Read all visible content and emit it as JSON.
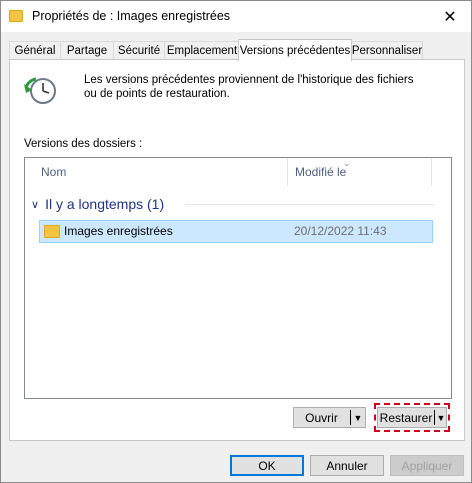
{
  "window": {
    "title": "Propriétés de : Images enregistrées",
    "close_label": "✕"
  },
  "tabs": [
    {
      "label": "Général"
    },
    {
      "label": "Partage"
    },
    {
      "label": "Sécurité"
    },
    {
      "label": "Emplacement"
    },
    {
      "label": "Versions précédentes"
    },
    {
      "label": "Personnaliser"
    }
  ],
  "active_tab": "Versions précédentes",
  "info": {
    "text": "Les versions précédentes proviennent de l'historique des fichiers ou de points de restauration.",
    "icon": "restore-clock-icon"
  },
  "folder_versions": {
    "label": "Versions des dossiers :",
    "columns": {
      "name": "Nom",
      "modified": "Modifié le"
    },
    "groups": [
      {
        "title": "Il y a longtemps (1)",
        "items": [
          {
            "name": "Images enregistrées",
            "modified": "20/12/2022 11:43",
            "icon": "folder-icon",
            "selected": true
          }
        ]
      }
    ]
  },
  "actions": {
    "open_label": "Ouvrir",
    "restore_label": "Restaurer",
    "dropdown_glyph": "▼"
  },
  "dialog_buttons": {
    "ok": "OK",
    "cancel": "Annuler",
    "apply": "Appliquer"
  },
  "colors": {
    "accent": "#0078d7",
    "selection": "#cce8ff",
    "group_title": "#1e3287",
    "highlight_box": "#d0001a"
  }
}
